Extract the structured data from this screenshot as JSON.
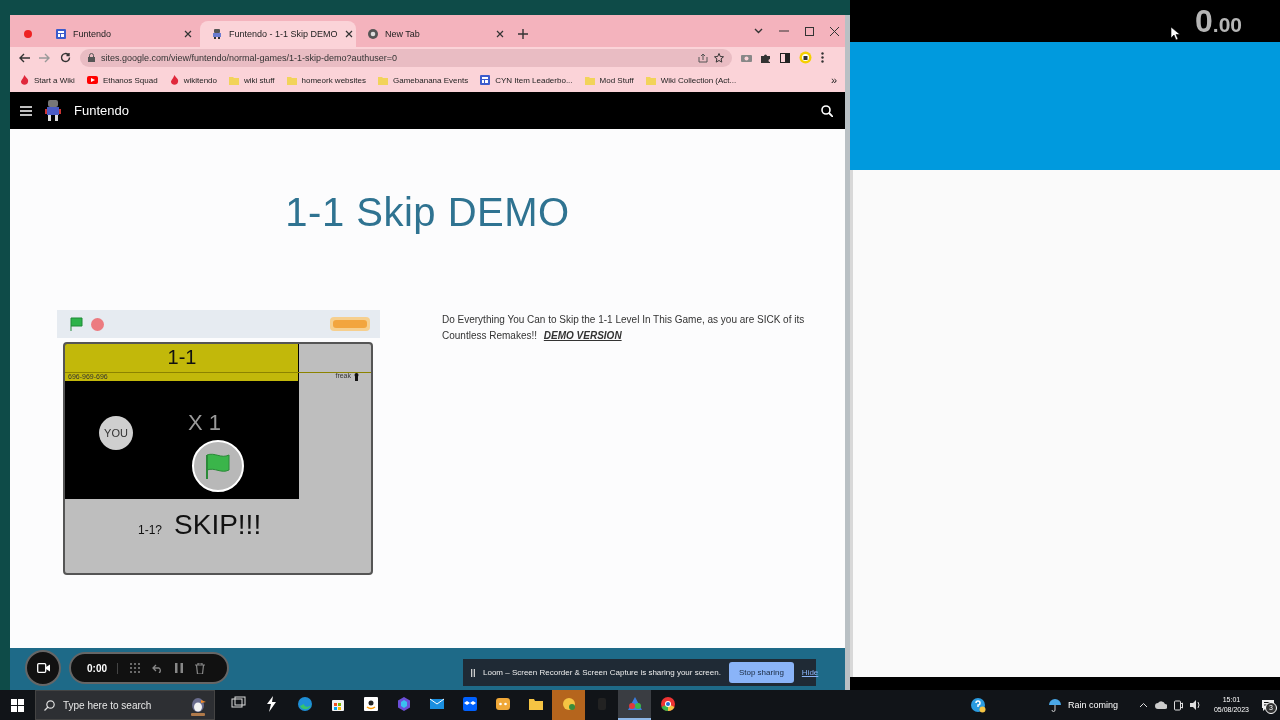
{
  "browser": {
    "tabs": [
      {
        "title": "Funtendo",
        "kind": "sites",
        "selected": false
      },
      {
        "title": "Funtendo - 1-1 Skip DEMO",
        "kind": "mascot",
        "selected": true
      },
      {
        "title": "New Tab",
        "kind": "chrome",
        "selected": false
      }
    ],
    "url": "sites.google.com/view/funtendo/normal-games/1-1-skip-demo?authuser=0",
    "bookmarks": [
      {
        "label": "Start a Wiki",
        "kind": "flame"
      },
      {
        "label": "Ethanos Squad",
        "kind": "video"
      },
      {
        "label": "wikitendo",
        "kind": "flame"
      },
      {
        "label": "wiki stuff",
        "kind": "folder"
      },
      {
        "label": "homeork websites",
        "kind": "folder"
      },
      {
        "label": "Gamebanana Events",
        "kind": "folder"
      },
      {
        "label": "CYN Item Leaderbo...",
        "kind": "sites"
      },
      {
        "label": "Mod Stuff",
        "kind": "folder"
      },
      {
        "label": "Wiki Collection (Act...",
        "kind": "folder"
      }
    ],
    "more": "»"
  },
  "site": {
    "name": "Funtendo",
    "title": "1-1 Skip DEMO",
    "description": "Do Everything You Can to Skip the 1-1 Level In This Game, as you are SICK of its Countless Remakes!!",
    "link": "DEMO VERSION",
    "game": {
      "level": "1-1",
      "code": "696-969-696",
      "tag": "freak",
      "player": "YOU",
      "lives": "X 1",
      "question": "1-1?",
      "action": "SKIP!!!"
    }
  },
  "loom": {
    "timer": "0:00",
    "message": "Loom – Screen Recorder & Screen Capture is sharing your screen.",
    "stop": "Stop sharing",
    "hide": "Hide"
  },
  "side_panel": {
    "counter": "0",
    "fraction": ".00"
  },
  "taskbar": {
    "search_placeholder": "Type here to search",
    "apps": [
      {
        "kind": "task-view",
        "active": false,
        "flashing": false
      },
      {
        "kind": "lightning",
        "active": false,
        "flashing": false
      },
      {
        "kind": "edge",
        "active": false,
        "flashing": false
      },
      {
        "kind": "store",
        "active": false,
        "flashing": false
      },
      {
        "kind": "amazon",
        "active": false,
        "flashing": false
      },
      {
        "kind": "hexagon",
        "active": false,
        "flashing": false
      },
      {
        "kind": "mail",
        "active": false,
        "flashing": false
      },
      {
        "kind": "dropbox",
        "active": false,
        "flashing": false
      },
      {
        "kind": "game",
        "active": false,
        "flashing": false
      },
      {
        "kind": "folder",
        "active": false,
        "flashing": false
      },
      {
        "kind": "orange",
        "active": false,
        "flashing": true
      },
      {
        "kind": "dim",
        "active": false,
        "flashing": false
      },
      {
        "kind": "paint",
        "active": true,
        "flashing": false
      },
      {
        "kind": "chrome",
        "active": false,
        "flashing": false
      }
    ],
    "weather": "Rain coming",
    "time": "15:01",
    "date": "05/08/2023",
    "notifications": "3"
  }
}
